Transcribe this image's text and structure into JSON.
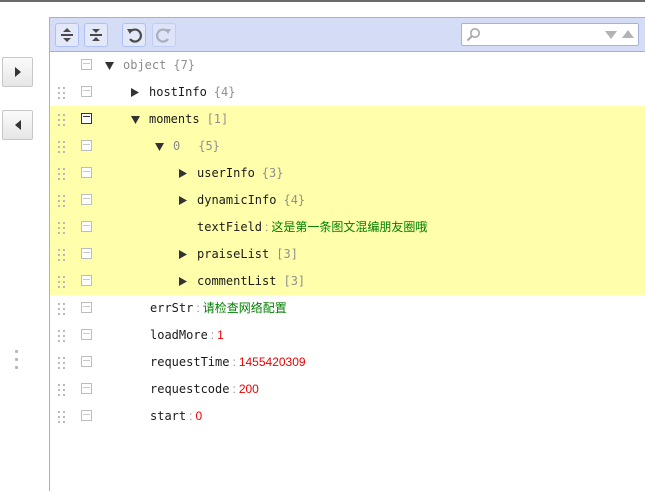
{
  "toolbar": {
    "expand_all": "expand-all",
    "collapse_all": "collapse-all",
    "undo": "undo",
    "redo": "redo",
    "search_placeholder": ""
  },
  "tree": {
    "root": {
      "key": "object",
      "count": "{7}"
    },
    "hostInfo": {
      "key": "hostInfo",
      "count": "{4}"
    },
    "moments": {
      "key": "moments",
      "count": "[1]"
    },
    "item0": {
      "key": "0",
      "count": "{5}"
    },
    "userInfo": {
      "key": "userInfo",
      "count": "{3}"
    },
    "dynamicInfo": {
      "key": "dynamicInfo",
      "count": "{4}"
    },
    "textField": {
      "key": "textField",
      "value": "这是第一条图文混编朋友圈哦"
    },
    "praiseList": {
      "key": "praiseList",
      "count": "[3]"
    },
    "commentList": {
      "key": "commentList",
      "count": "[3]"
    },
    "errStr": {
      "key": "errStr",
      "value": "请检查网络配置"
    },
    "loadMore": {
      "key": "loadMore",
      "value": "1"
    },
    "requestTime": {
      "key": "requestTime",
      "value": "1455420309"
    },
    "requestcode": {
      "key": "requestcode",
      "value": "200"
    },
    "start": {
      "key": "start",
      "value": "0"
    },
    "separator": ":"
  },
  "colors": {
    "toolbar_bg": "#d5ddf6",
    "border": "#97b0f8",
    "highlight": "#ffffab",
    "string_value": "#008000",
    "number_value": "#ee0000"
  }
}
